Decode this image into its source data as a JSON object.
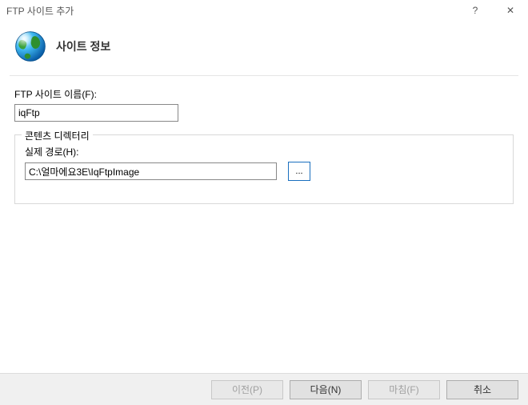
{
  "titlebar": {
    "title": "FTP 사이트 추가",
    "help": "?",
    "close": "✕"
  },
  "header": {
    "heading": "사이트 정보"
  },
  "form": {
    "siteNameLabel": "FTP 사이트 이름(F):",
    "siteNameValue": "iqFtp",
    "contentDir": {
      "legend": "콘텐츠 디렉터리",
      "pathLabel": "실제 경로(H):",
      "pathValue": "C:\\얼마에요3E\\IqFtpImage",
      "browseLabel": "..."
    }
  },
  "footer": {
    "prev": "이전(P)",
    "next": "다음(N)",
    "finish": "마침(F)",
    "cancel": "취소"
  }
}
